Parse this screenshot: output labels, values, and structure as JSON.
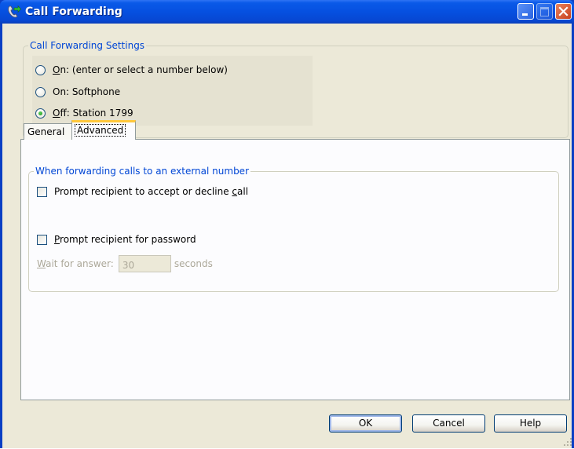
{
  "window": {
    "title": "Call Forwarding",
    "icon": "phone-forward-icon"
  },
  "settings_group": {
    "legend": "Call Forwarding Settings",
    "options": [
      {
        "label_mnemonic": "O",
        "label_rest": "n: (enter or select a number below)",
        "checked": false
      },
      {
        "label_mnemonic": "",
        "label_rest": "On: Softphone",
        "checked": false
      },
      {
        "label_mnemonic": "O",
        "label_rest": "ff: Station 1799",
        "checked": true
      }
    ]
  },
  "tabs": [
    {
      "label": "General",
      "active": false
    },
    {
      "label": "Advanced",
      "active": true
    }
  ],
  "external_group": {
    "legend": "When forwarding calls to an external number",
    "accept_decline": {
      "label_pre": "Prompt recipient to accept or decline ",
      "label_mnemonic": "c",
      "label_post": "all",
      "checked": false
    },
    "password": {
      "label_mnemonic": "P",
      "label_rest": "rompt recipient for password",
      "checked": false
    },
    "wait": {
      "label_mnemonic": "W",
      "label_rest": "ait for answer:",
      "value": "30",
      "unit": "seconds"
    }
  },
  "buttons": {
    "ok": "OK",
    "cancel": "Cancel",
    "help": "Help"
  },
  "colors": {
    "title_bar": "#0650e0",
    "legend_text": "#0046d5",
    "tab_highlight": "#ffc83c",
    "dialog_bg": "#ece9d8"
  }
}
